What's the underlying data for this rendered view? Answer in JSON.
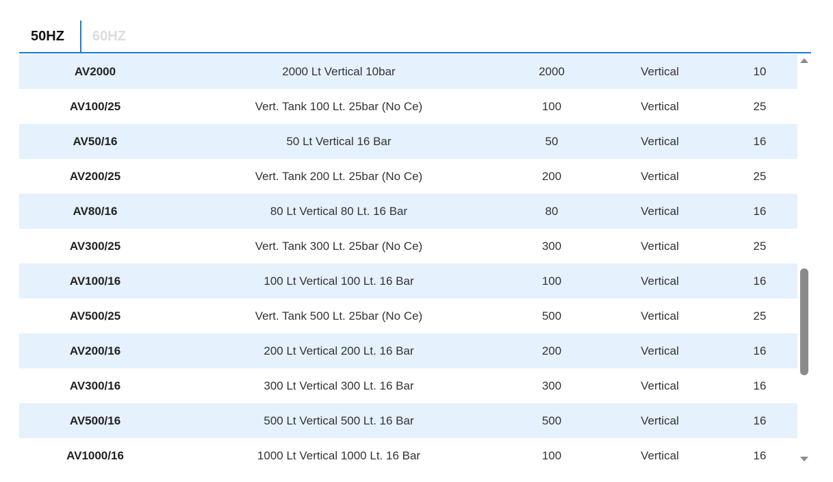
{
  "tabs": [
    {
      "label": "50HZ",
      "active": true
    },
    {
      "label": "60HZ",
      "active": false
    }
  ],
  "colors": {
    "accent": "#1b7ad4",
    "row_alt": "#e5f1fd",
    "inactive_tab": "#dcdcdc"
  },
  "rows": [
    {
      "code": "AV2000",
      "description": "2000 Lt Vertical 10bar",
      "capacity": "2000",
      "type": "Vertical",
      "bar": "10"
    },
    {
      "code": "AV100/25",
      "description": "Vert. Tank 100 Lt. 25bar (No Ce)",
      "capacity": "100",
      "type": "Vertical",
      "bar": "25"
    },
    {
      "code": "AV50/16",
      "description": "50 Lt Vertical 16 Bar",
      "capacity": "50",
      "type": "Vertical",
      "bar": "16"
    },
    {
      "code": "AV200/25",
      "description": "Vert. Tank 200 Lt. 25bar (No Ce)",
      "capacity": "200",
      "type": "Vertical",
      "bar": "25"
    },
    {
      "code": "AV80/16",
      "description": "80 Lt Vertical 80 Lt. 16 Bar",
      "capacity": "80",
      "type": "Vertical",
      "bar": "16"
    },
    {
      "code": "AV300/25",
      "description": "Vert. Tank 300 Lt. 25bar (No Ce)",
      "capacity": "300",
      "type": "Vertical",
      "bar": "25"
    },
    {
      "code": "AV100/16",
      "description": "100 Lt Vertical 100 Lt. 16 Bar",
      "capacity": "100",
      "type": "Vertical",
      "bar": "16"
    },
    {
      "code": "AV500/25",
      "description": "Vert. Tank 500 Lt. 25bar (No Ce)",
      "capacity": "500",
      "type": "Vertical",
      "bar": "25"
    },
    {
      "code": "AV200/16",
      "description": "200 Lt Vertical 200 Lt. 16 Bar",
      "capacity": "200",
      "type": "Vertical",
      "bar": "16"
    },
    {
      "code": "AV300/16",
      "description": "300 Lt Vertical 300 Lt. 16 Bar",
      "capacity": "300",
      "type": "Vertical",
      "bar": "16"
    },
    {
      "code": "AV500/16",
      "description": "500 Lt Vertical 500 Lt. 16 Bar",
      "capacity": "500",
      "type": "Vertical",
      "bar": "16"
    },
    {
      "code": "AV1000/16",
      "description": "1000 Lt Vertical 1000 Lt. 16 Bar",
      "capacity": "100",
      "type": "Vertical",
      "bar": "16"
    }
  ],
  "scrollbar": {
    "up_icon": "triangle-up",
    "down_icon": "triangle-down"
  }
}
